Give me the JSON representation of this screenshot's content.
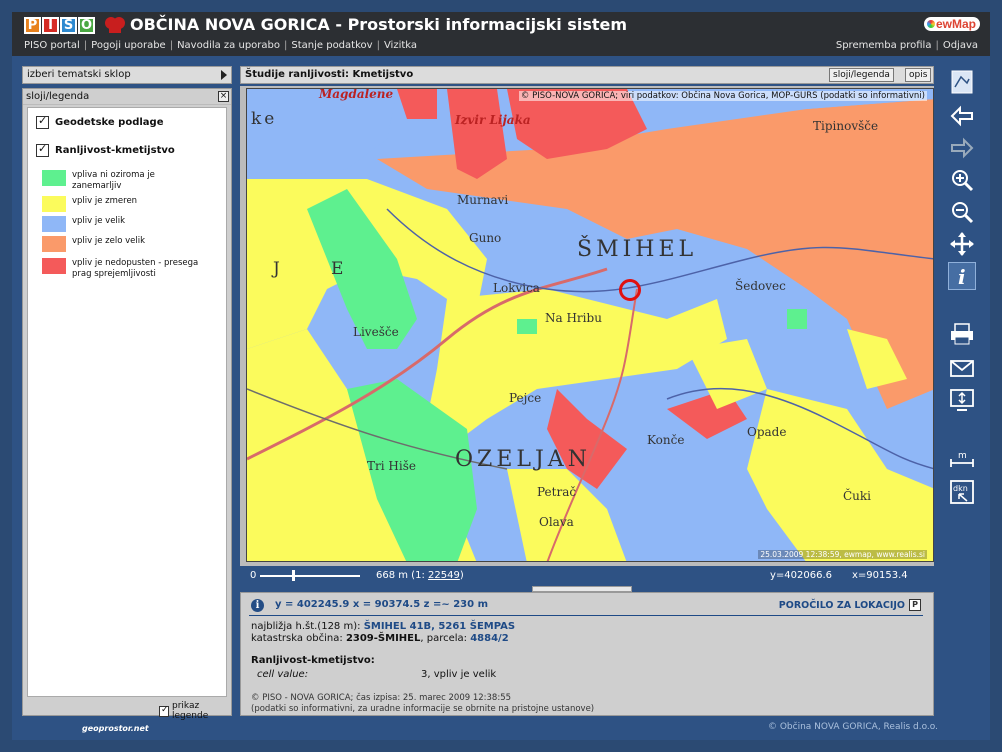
{
  "header": {
    "logo_letters": [
      "P",
      "I",
      "S",
      "O"
    ],
    "title": "OBČINA NOVA GORICA - Prostorski informacijski sistem",
    "brand": "ewMap",
    "nav": [
      "PISO portal",
      "Pogoji uporabe",
      "Navodila za uporabo",
      "Stanje podatkov",
      "Vizitka"
    ],
    "nav_right": [
      "Sprememba profila",
      "Odjava"
    ]
  },
  "left_panel": {
    "theme_select": "izberi tematski sklop",
    "legend_title": "sloji/legenda",
    "close_label": "×",
    "layers": [
      {
        "name": "Geodetske podlage",
        "checked": true
      },
      {
        "name": "Ranljivost-kmetijstvo",
        "checked": true
      }
    ],
    "legend_items": [
      {
        "label": "vpliva ni oziroma je zanemarljiv",
        "color": "#5ef08f"
      },
      {
        "label": "vpliv je zmeren",
        "color": "#fbfb5c"
      },
      {
        "label": "vpliv je velik",
        "color": "#8fb7f7"
      },
      {
        "label": "vpliv je zelo velik",
        "color": "#fa9a6a"
      },
      {
        "label": "vpliv je nedopusten - presega prag sprejemljivosti",
        "color": "#f45a5a"
      }
    ],
    "show_legend": "prikaz legende",
    "geoprostor": "geoprostor.net"
  },
  "map": {
    "title": "Študije ranljivosti: Kmetijstvo",
    "btn_layers": "sloji/legenda",
    "btn_desc": "opis",
    "copyright_top": "© PISO-NOVA GORICA; viri podatkov: Občina Nova Gorica, MOP-GURS (podatki so informativni)",
    "copyright_bottom": "25.03.2009 12:38:59, ewmap, www.realis.si",
    "places": [
      "Magdalene",
      "ke",
      "Izvir Lijaka",
      "Murnavi",
      "Guno",
      "ŠMIHEL",
      "Lokvica",
      "Na Hribu",
      "Šedovec",
      "Tipinovšče",
      "Livešče",
      "Pejce",
      "OZELJAN",
      "Tri Hiše",
      "Konče",
      "Opade",
      "Petrač",
      "Olava",
      "Čuki",
      "J",
      "E"
    ],
    "scale_start": "0",
    "scale_text": "668 m (1:",
    "scale_value": "22549",
    "scale_close": ")",
    "coord_y": "y=402066.6",
    "coord_x": "x=90153.4"
  },
  "info": {
    "coords": "y = 402245.9   x = 90374.5   z =~ 230 m",
    "report_label": "POROČILO ZA LOKACIJO",
    "report_icon": "P",
    "nearest_label": "najbližja h.št.(128 m):",
    "nearest_value": "ŠMIHEL 41B, 5261 ŠEMPAS",
    "cadastral_label": "katastrska občina:",
    "cadastral_value": "2309-ŠMIHEL",
    "parcel_label": ", parcela:",
    "parcel_value": "4884/2",
    "layer_title": "Ranljivost-kmetijstvo:",
    "cell_label": "cell value:",
    "cell_value": "3, vpliv je velik",
    "footnote1": "© PISO - NOVA GORICA; čas izpisa: 25. marec 2009 12:38:55",
    "footnote2": "(podatki so informativni, za uradne informacije se obrnite na pristojne ustanove)"
  },
  "toolbar": {
    "icons": [
      "overview-icon",
      "back-arrow-icon",
      "forward-arrow-icon",
      "zoom-in-icon",
      "zoom-out-icon",
      "pan-icon",
      "info-icon",
      "print-icon",
      "mail-icon",
      "export-icon",
      "measure-icon",
      "dkn-icon"
    ],
    "active": "info-icon",
    "measure_label": "m",
    "dkn_label": "dkn"
  },
  "footer": {
    "copyright": "© Občina NOVA GORICA, Realis d.o.o."
  }
}
